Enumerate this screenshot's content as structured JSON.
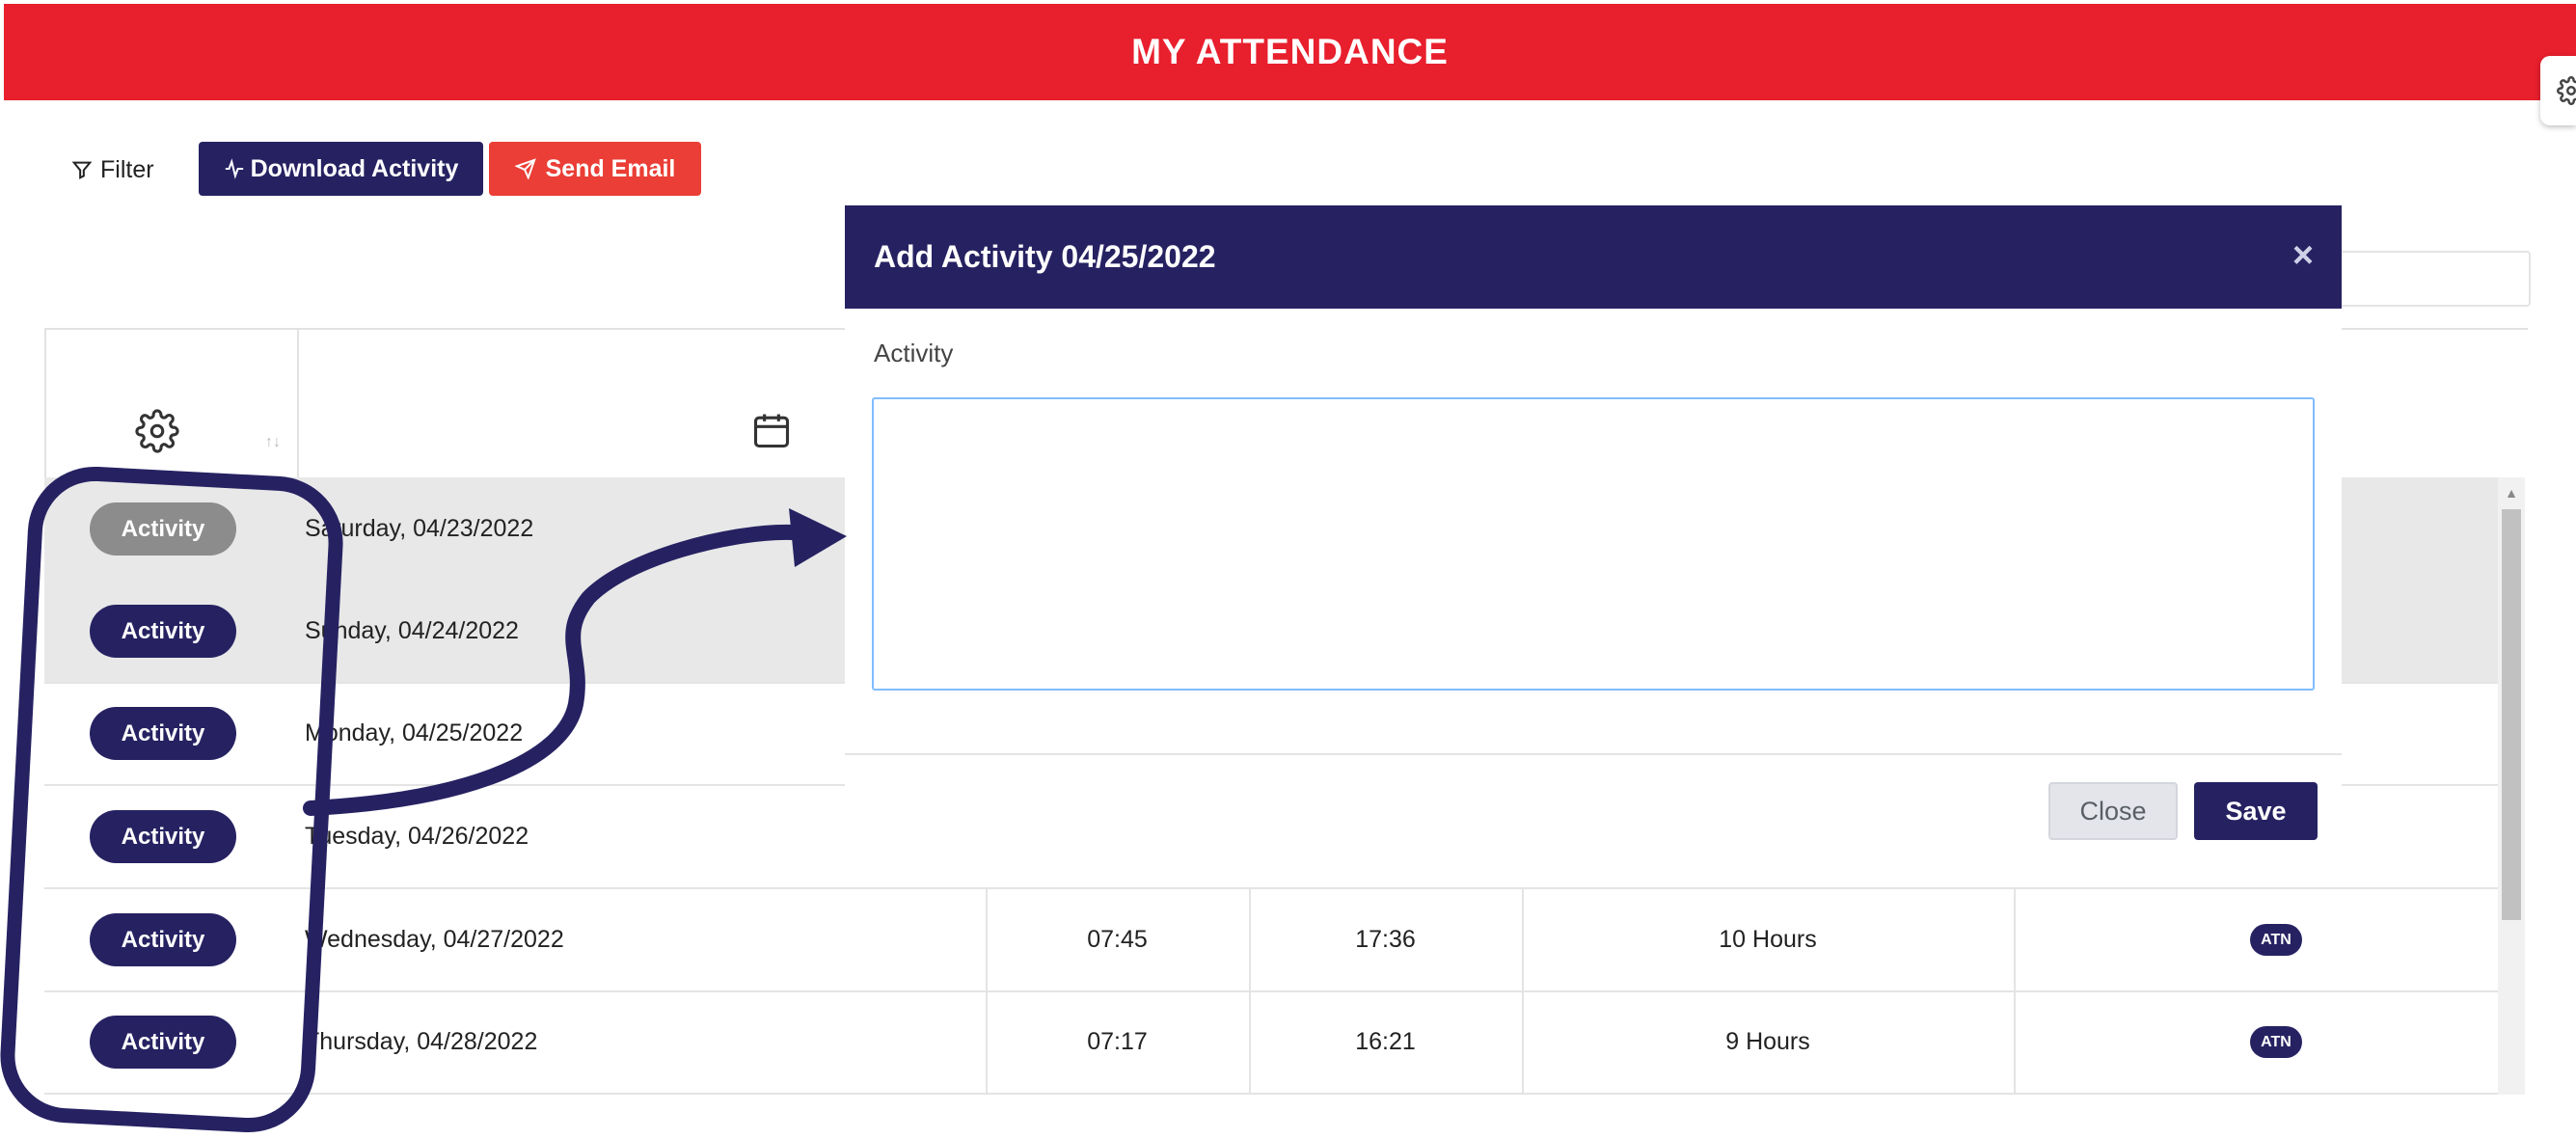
{
  "header": {
    "title": "MY ATTENDANCE"
  },
  "toolbar": {
    "filter_label": "Filter",
    "download_label": "Download Activity",
    "email_label": "Send Email"
  },
  "table": {
    "rows": [
      {
        "button": "Activity",
        "date": "Saturday, 04/23/2022",
        "in": "",
        "out": "",
        "hours": "",
        "badge": "",
        "disabled": true
      },
      {
        "button": "Activity",
        "date": "Sunday, 04/24/2022",
        "in": "",
        "out": "",
        "hours": "",
        "badge": ""
      },
      {
        "button": "Activity",
        "date": "Monday, 04/25/2022",
        "in": "",
        "out": "",
        "hours": "",
        "badge": ""
      },
      {
        "button": "Activity",
        "date": "Tuesday, 04/26/2022",
        "in": "",
        "out": "",
        "hours": "",
        "badge": ""
      },
      {
        "button": "Activity",
        "date": "Wednesday, 04/27/2022",
        "in": "07:45",
        "out": "17:36",
        "hours": "10 Hours",
        "badge": "ATN"
      },
      {
        "button": "Activity",
        "date": "Thursday, 04/28/2022",
        "in": "07:17",
        "out": "16:21",
        "hours": "9 Hours",
        "badge": "ATN"
      }
    ]
  },
  "modal": {
    "title": "Add Activity 04/25/2022",
    "close_symbol": "×",
    "field_label": "Activity",
    "field_value": "",
    "close_label": "Close",
    "save_label": "Save"
  },
  "colors": {
    "header_red": "#e81f2d",
    "navy": "#262262",
    "email_red": "#ea3e36",
    "disabled_gray": "#8c8c8c"
  },
  "icons": [
    "filter-icon",
    "activity-pulse-icon",
    "send-icon",
    "gear-icon",
    "calendar-icon",
    "sort-icon"
  ]
}
